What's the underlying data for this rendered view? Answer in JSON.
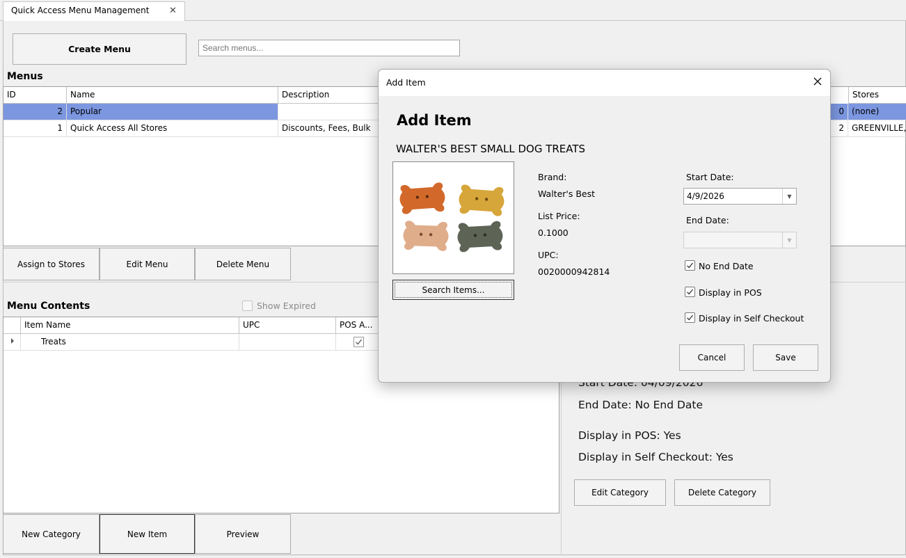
{
  "tab": {
    "label": "Quick Access Menu Management",
    "close_glyph": "✕"
  },
  "toolbar": {
    "create_menu": "Create Menu",
    "search_placeholder": "Search menus..."
  },
  "menus": {
    "title": "Menus",
    "columns": [
      "ID",
      "Name",
      "Description",
      "Stores"
    ],
    "rows": [
      {
        "id": "2",
        "name": "Popular",
        "description": "",
        "store_count": "0",
        "stores": "(none)",
        "selected": true
      },
      {
        "id": "1",
        "name": "Quick Access All Stores",
        "description": "Discounts, Fees, Bulk",
        "store_count": "2",
        "stores": "GREENVILLE,",
        "selected": false
      }
    ],
    "buttons": {
      "assign": "Assign to Stores",
      "edit": "Edit Menu",
      "delete": "Delete Menu"
    }
  },
  "contents": {
    "title": "Menu Contents",
    "show_expired": "Show Expired",
    "columns": [
      "Item Name",
      "UPC",
      "POS A..."
    ],
    "rows": [
      {
        "name": "Treats",
        "upc": "",
        "pos": true
      }
    ],
    "buttons": {
      "new_category": "New Category",
      "new_item": "New Item",
      "preview": "Preview"
    }
  },
  "details": {
    "start_date": "Start Date: 04/09/2026",
    "end_date": "End Date: No End Date",
    "display_pos": "Display in POS: Yes",
    "display_self": "Display in Self Checkout: Yes",
    "edit_category": "Edit Category",
    "delete_category": "Delete Category"
  },
  "dialog": {
    "window_title": "Add Item",
    "heading": "Add Item",
    "product_name": "WALTER'S BEST SMALL DOG TREATS",
    "search_items": "Search Items...",
    "brand_label": "Brand:",
    "brand_value": "Walter's Best",
    "price_label": "List Price:",
    "price_value": "0.1000",
    "upc_label": "UPC:",
    "upc_value": "0020000942814",
    "start_label": "Start Date:",
    "start_value": "4/9/2026",
    "end_label": "End Date:",
    "end_value": "",
    "no_end_date": "No End Date",
    "display_pos": "Display in POS",
    "display_self": "Display in Self Checkout",
    "cancel": "Cancel",
    "save": "Save"
  },
  "colors": {
    "selection": "#7c97e0",
    "accent_border": "#2b2b2b"
  }
}
